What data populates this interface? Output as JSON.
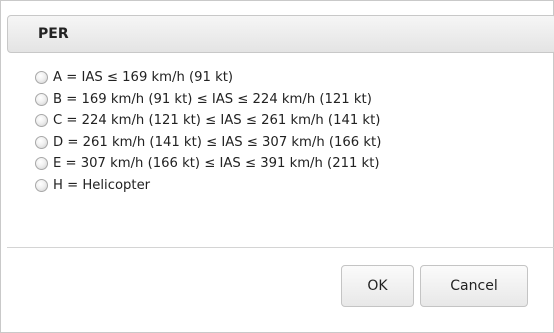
{
  "dialog": {
    "title": "PER",
    "options": [
      {
        "label": "A = IAS ≤ 169 km/h (91 kt)",
        "selected": false
      },
      {
        "label": "B = 169 km/h (91 kt) ≤ IAS ≤ 224 km/h (121 kt)",
        "selected": false
      },
      {
        "label": "C = 224 km/h (121 kt) ≤ IAS ≤ 261 km/h (141 kt)",
        "selected": false
      },
      {
        "label": "D = 261 km/h (141 kt) ≤ IAS ≤ 307 km/h (166 kt)",
        "selected": false
      },
      {
        "label": "E = 307 km/h (166 kt) ≤ IAS ≤ 391 km/h (211 kt)",
        "selected": false
      },
      {
        "label": "H = Helicopter",
        "selected": false
      }
    ],
    "buttons": {
      "ok_label": "OK",
      "cancel_label": "Cancel"
    }
  }
}
